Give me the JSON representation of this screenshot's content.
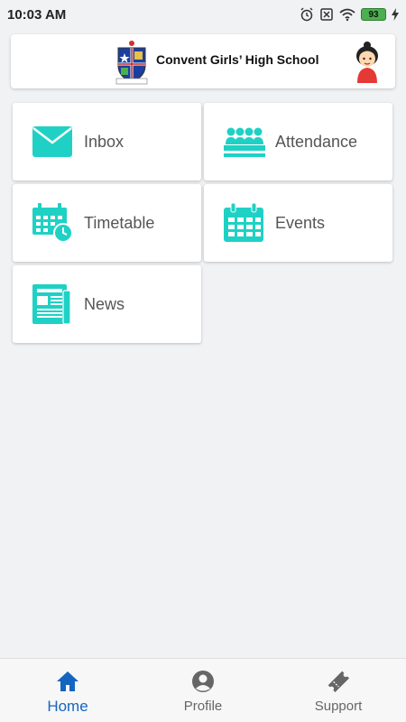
{
  "status_bar": {
    "time": "10:03 AM",
    "battery": "93"
  },
  "header": {
    "school_name": "Convent Girls’ High School"
  },
  "tiles": [
    {
      "label": "Inbox",
      "icon": "envelope-icon"
    },
    {
      "label": "Attendance",
      "icon": "group-icon"
    },
    {
      "label": "Timetable",
      "icon": "calendar-clock-icon"
    },
    {
      "label": "Events",
      "icon": "calendar-icon"
    },
    {
      "label": "News",
      "icon": "newspaper-icon"
    }
  ],
  "nav": {
    "items": [
      {
        "label": "Home",
        "icon": "home-icon",
        "active": true
      },
      {
        "label": "Profile",
        "icon": "profile-icon",
        "active": false
      },
      {
        "label": "Support",
        "icon": "ticket-icon",
        "active": false
      }
    ]
  },
  "colors": {
    "accent": "#1fd1c4",
    "nav_active": "#1565c0",
    "background": "#f1f2f4"
  }
}
